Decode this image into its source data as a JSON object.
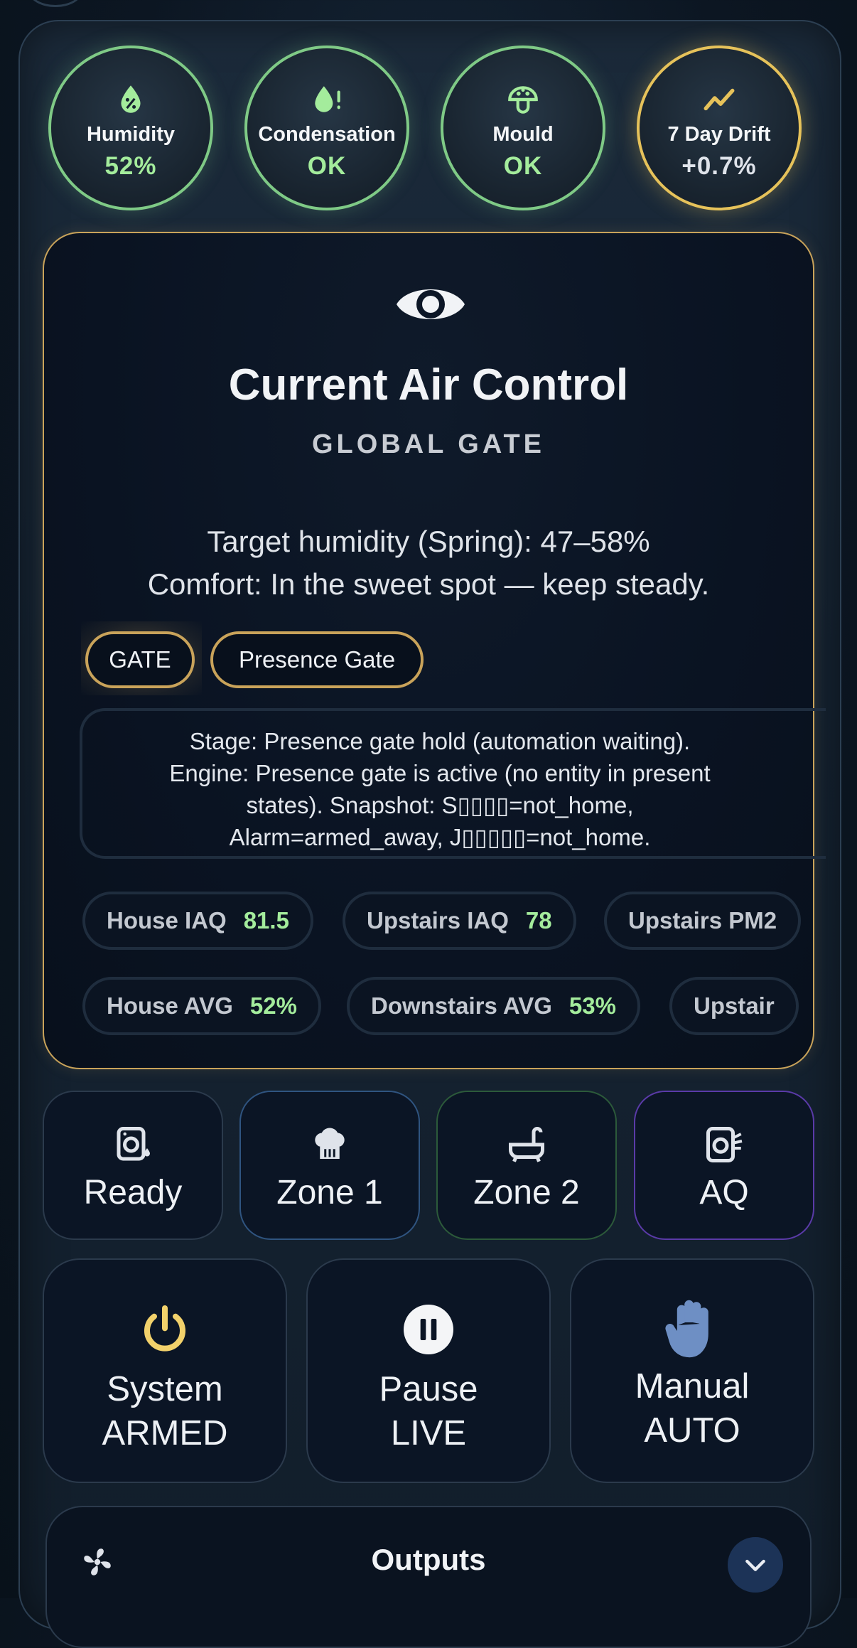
{
  "gauges": [
    {
      "label": "Humidity",
      "value": "52%",
      "icon": "humidity-percent-icon"
    },
    {
      "label": "Condensation",
      "value": "OK",
      "icon": "water-alert-icon"
    },
    {
      "label": "Mould",
      "value": "OK",
      "icon": "mushroom-icon"
    },
    {
      "label": "7 Day Drift",
      "value": "+0.7%",
      "icon": "trend-up-icon"
    }
  ],
  "card": {
    "title": "Current Air Control",
    "subtitle": "GLOBAL GATE",
    "target": "Target humidity (Spring): 47–58%",
    "comfort": "Comfort: In the sweet spot — keep steady.",
    "chips": [
      "GATE",
      "Presence Gate"
    ],
    "stage_lines": [
      "Stage: Presence gate hold (automation waiting).",
      "Engine: Presence gate is active (no entity in present",
      "states). Snapshot: S▯▯▯▯=not_home,",
      "Alarm=armed_away, J▯▯▯▯▯=not_home."
    ],
    "pills_row1": [
      {
        "label": "House IAQ",
        "value": "81.5"
      },
      {
        "label": "Upstairs IAQ",
        "value": "78"
      },
      {
        "label": "Upstairs PM2",
        "value": ""
      }
    ],
    "pills_row2": [
      {
        "label": "House AVG",
        "value": "52%"
      },
      {
        "label": "Downstairs AVG",
        "value": "53%"
      },
      {
        "label": "Upstair",
        "value": ""
      }
    ]
  },
  "zones": [
    {
      "label": "Ready",
      "icon": "washing-machine-icon"
    },
    {
      "label": "Zone 1",
      "icon": "chef-hat-icon"
    },
    {
      "label": "Zone 2",
      "icon": "bathtub-icon"
    },
    {
      "label": "AQ",
      "icon": "air-quality-icon"
    }
  ],
  "controls": [
    {
      "line1": "System",
      "line2": "ARMED",
      "icon": "power-icon",
      "color": "#f2d16b"
    },
    {
      "line1": "Pause",
      "line2": "LIVE",
      "icon": "pause-icon",
      "color": "#f4f5f7"
    },
    {
      "line1": "Manual",
      "line2": "AUTO",
      "icon": "hand-icon",
      "color": "#6e8fc4"
    }
  ],
  "outputs": {
    "title": "Outputs",
    "icon": "fan-icon",
    "toggle_icon": "chevron-down-icon"
  },
  "colors": {
    "ok": "#7fca86",
    "warn": "#e6c25a",
    "value_green": "#a4ec9c",
    "card_border": "#c9a35a"
  }
}
